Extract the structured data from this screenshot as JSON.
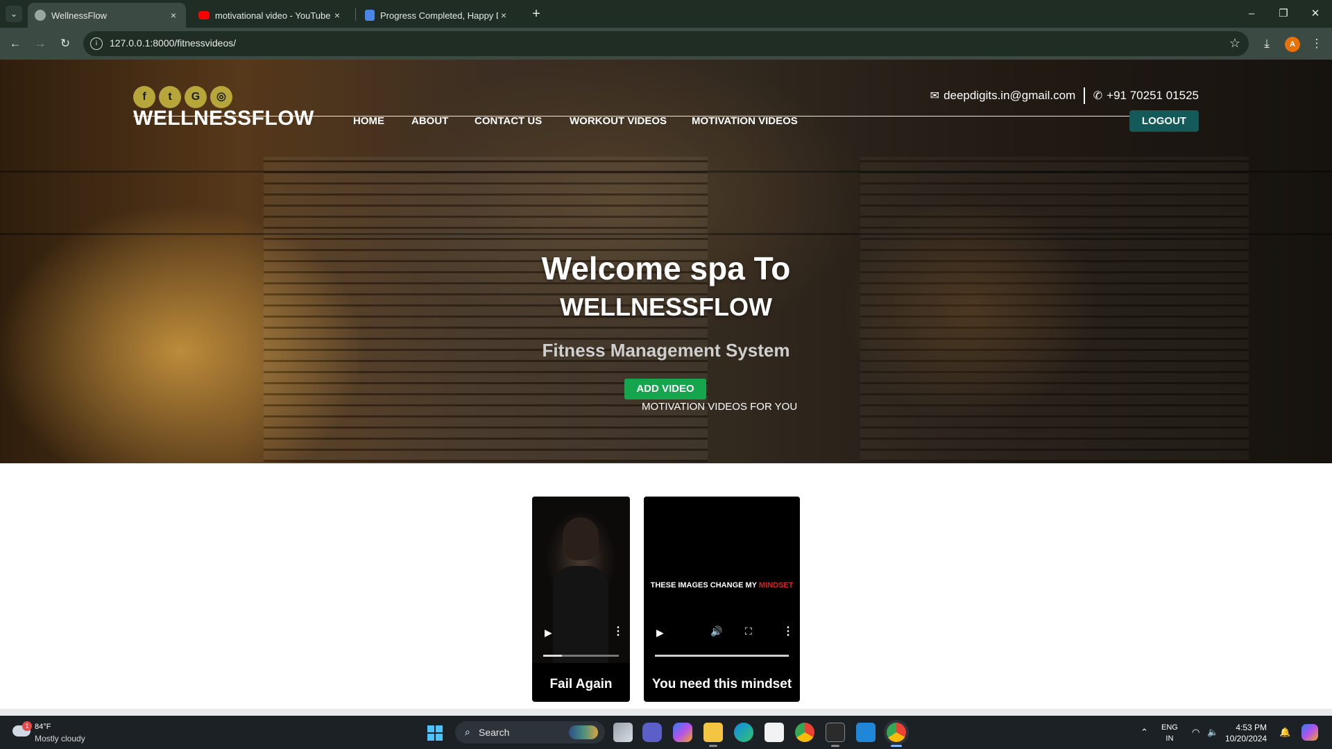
{
  "browser": {
    "tabs": [
      {
        "title": "WellnessFlow",
        "active": true
      },
      {
        "title": "motivational video - YouTube",
        "active": false
      },
      {
        "title": "Progress Completed, Happy Do",
        "active": false
      }
    ],
    "url": "127.0.0.1:8000/fitnessvideos/",
    "profile_initial": "A",
    "tab_close_glyph": "×",
    "new_tab_glyph": "+"
  },
  "site": {
    "contact": {
      "email": "deepdigits.in@gmail.com",
      "phone": "+91 70251 01525"
    },
    "social": [
      {
        "icon": "facebook-icon",
        "glyph": "f"
      },
      {
        "icon": "twitter-icon",
        "glyph": "t"
      },
      {
        "icon": "google-icon",
        "glyph": "G"
      },
      {
        "icon": "instagram-icon",
        "glyph": "◎"
      }
    ],
    "brand": "WELLNESSFLOW",
    "nav": [
      "HOME",
      "ABOUT",
      "CONTACT US",
      "WORKOUT VIDEOS",
      "MOTIVATION VIDEOS"
    ],
    "logout_label": "LOGOUT"
  },
  "hero": {
    "heading": "Welcome spa To",
    "brand": "WELLNESSFLOW",
    "subtitle": "Fitness Management System",
    "add_video_label": "ADD VIDEO",
    "marquee": "MOTIVATION VIDEOS FOR YOU"
  },
  "videos": [
    {
      "caption": "Fail Again",
      "progress": 0.25
    },
    {
      "caption": "You need this mindset",
      "overlay_text": "THESE IMAGES CHANGE MY",
      "overlay_highlight": "MINDSET",
      "progress": 0.0
    }
  ],
  "taskbar": {
    "weather_temp": "84°F",
    "weather_desc": "Mostly cloudy",
    "weather_badge": "1",
    "search_label": "Search",
    "lang_top": "ENG",
    "lang_bottom": "IN",
    "time": "4:53 PM",
    "date": "10/20/2024"
  },
  "colors": {
    "chrome_dark": "#1f2d25",
    "chrome_mid": "#3b4a42",
    "social_bg": "#b7a63a",
    "logout_bg": "#145a5a",
    "add_video_bg": "#15a54d",
    "taskbar_bg": "#1c2126"
  }
}
